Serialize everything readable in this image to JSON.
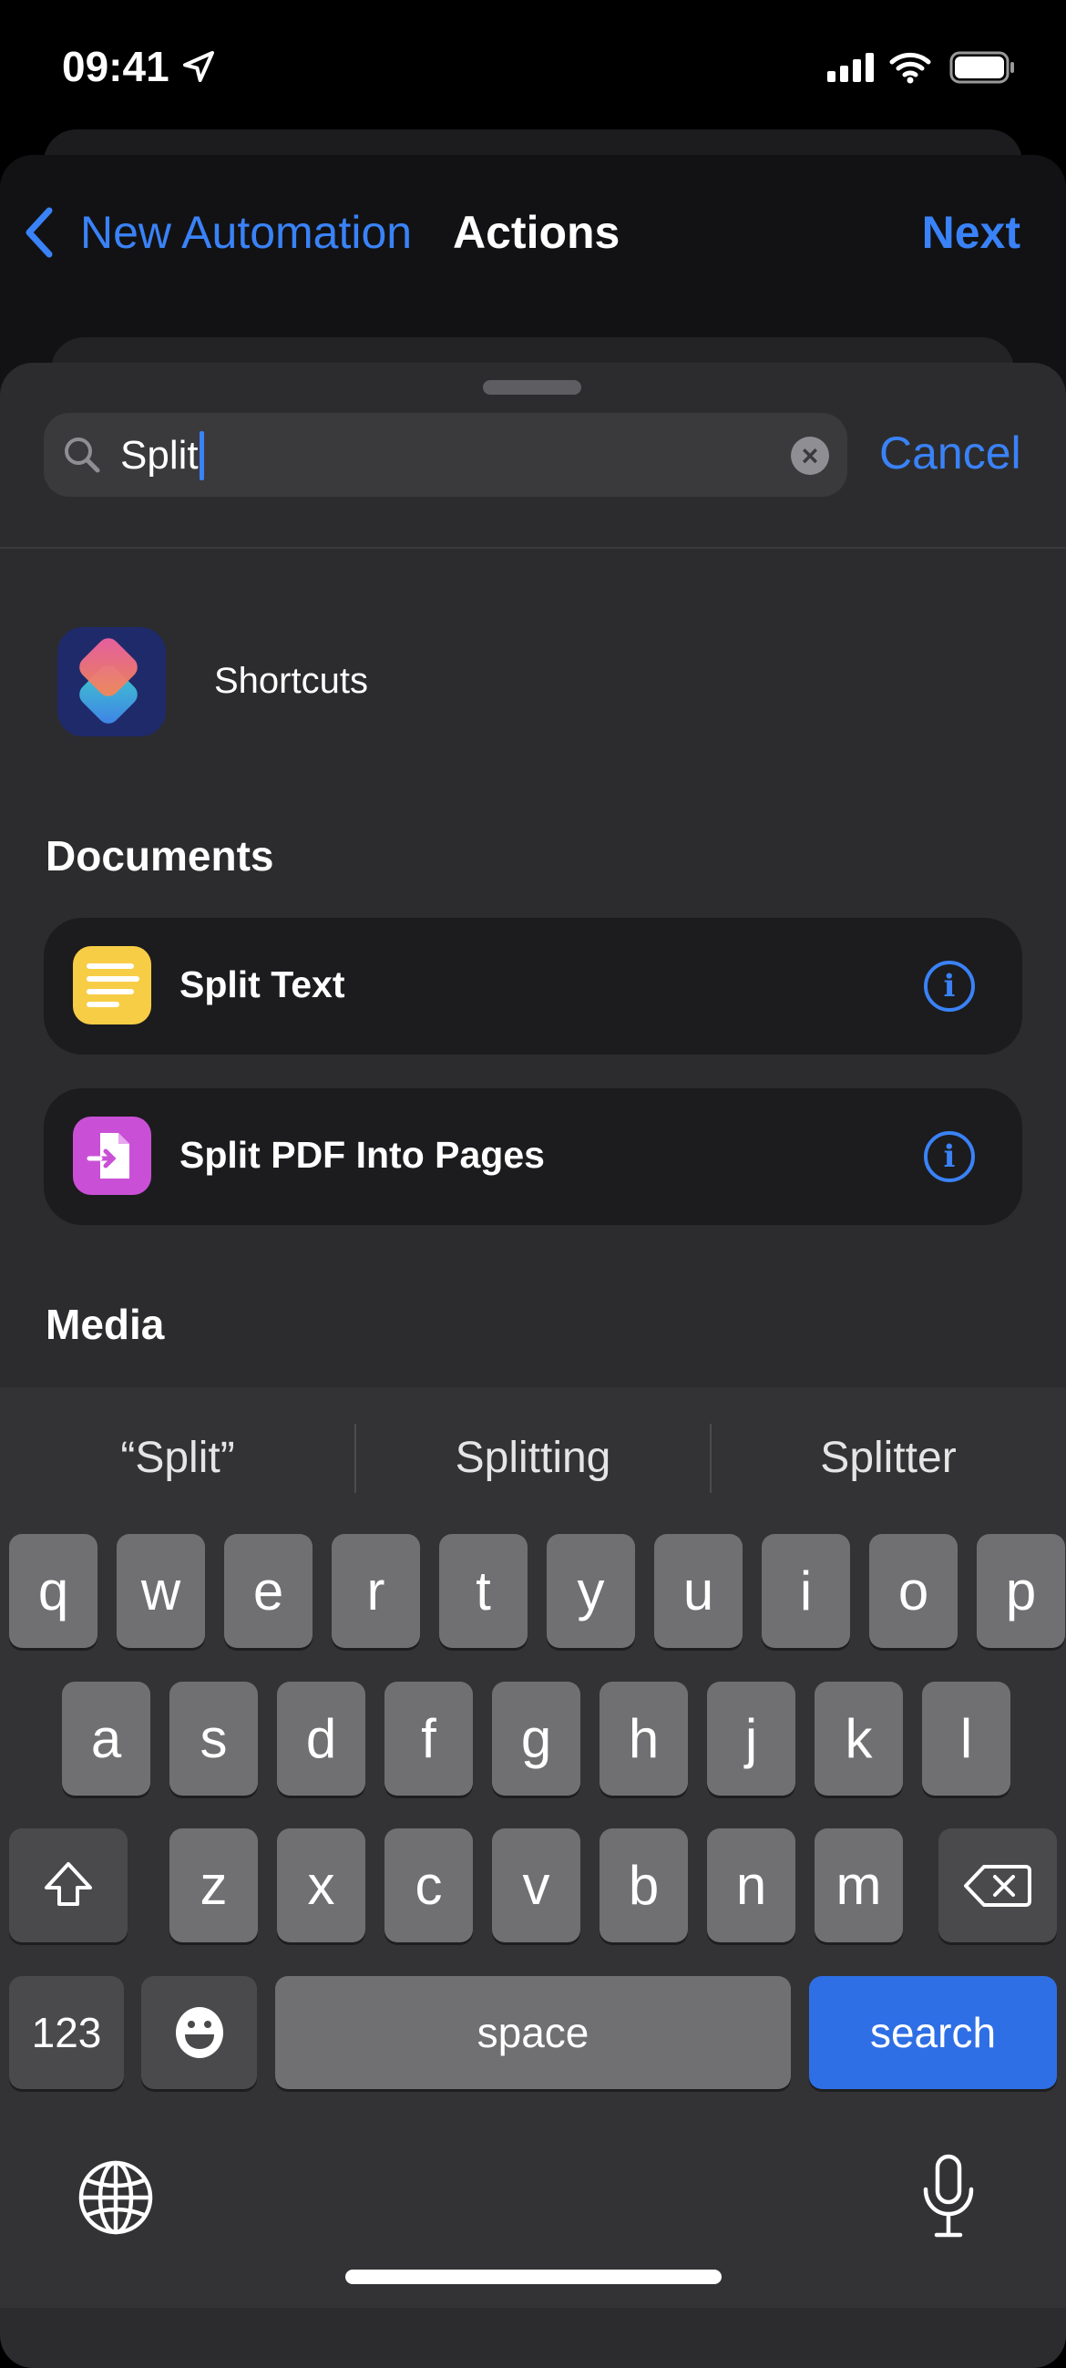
{
  "status_bar": {
    "time": "09:41",
    "icons": [
      "location-arrow-icon",
      "signal-icon",
      "wifi-icon",
      "battery-icon"
    ]
  },
  "nav": {
    "back_label": "New Automation",
    "title": "Actions",
    "next_label": "Next"
  },
  "search": {
    "value": "Split",
    "cancel_label": "Cancel"
  },
  "app_result": {
    "label": "Shortcuts"
  },
  "sections": [
    {
      "title": "Documents",
      "items": [
        {
          "label": "Split Text",
          "icon": "text-lines-icon",
          "color": "#f7cd46"
        },
        {
          "label": "Split PDF Into Pages",
          "icon": "pdf-split-icon",
          "color": "#c950d6"
        }
      ]
    },
    {
      "title": "Media",
      "items": []
    }
  ],
  "keyboard": {
    "suggestions": [
      "“Split”",
      "Splitting",
      "Splitter"
    ],
    "rows": [
      [
        "q",
        "w",
        "e",
        "r",
        "t",
        "y",
        "u",
        "i",
        "o",
        "p"
      ],
      [
        "a",
        "s",
        "d",
        "f",
        "g",
        "h",
        "j",
        "k",
        "l"
      ],
      [
        "z",
        "x",
        "c",
        "v",
        "b",
        "n",
        "m"
      ]
    ],
    "numbers_label": "123",
    "space_label": "space",
    "search_label": "search"
  },
  "colors": {
    "accent": "#3a82f7",
    "search_key": "#2f6fe5"
  }
}
